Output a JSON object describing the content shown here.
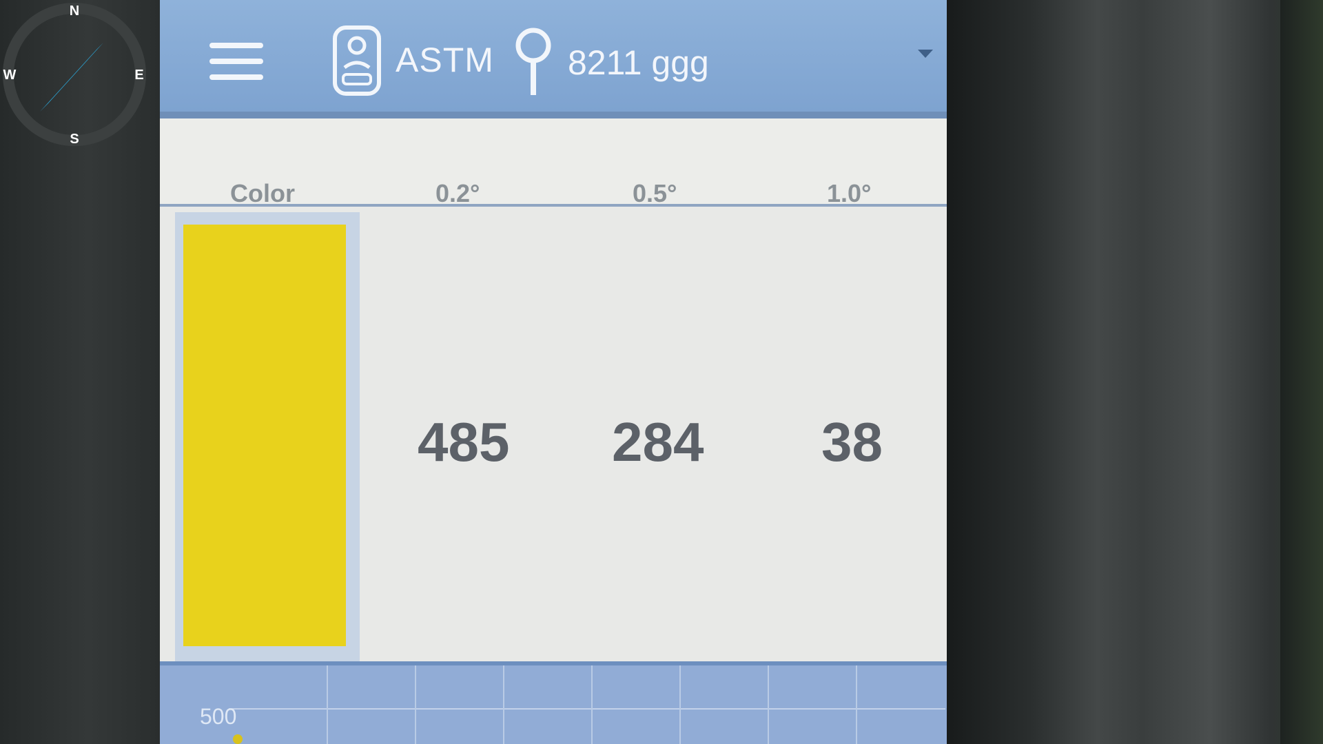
{
  "compass": {
    "n": "N",
    "e": "E",
    "s": "S",
    "w": "W"
  },
  "topbar": {
    "device_label": "ASTM",
    "location_label": "8211 ggg"
  },
  "table": {
    "headers": [
      "Color",
      "0.2°",
      "0.5°",
      "1.0°"
    ],
    "swatch_color": "#e8d21c",
    "values": [
      "485",
      "284",
      "38"
    ]
  },
  "graph": {
    "y_tick": "500"
  }
}
